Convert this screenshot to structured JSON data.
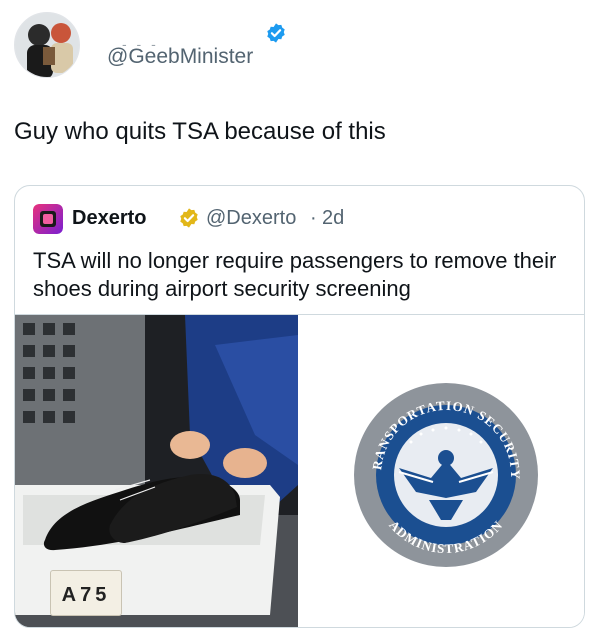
{
  "author": {
    "handle": "@GeebMinister",
    "name_redacted": "- - -",
    "verified_icon": "verified-badge-icon",
    "verified_color": "#1d9bf0"
  },
  "tweet": {
    "text": "Guy who quits TSA because of this"
  },
  "quoted": {
    "name": "Dexerto",
    "badge_icon": "gold-verified-badge-icon",
    "badge_color": "#e2b719",
    "handle": "@Dexerto",
    "separator": "·",
    "time": "2d",
    "text": "TSA will no longer require passengers to remove their shoes during airport security screening",
    "media": {
      "left_photo": "shoes-in-security-bin-photo",
      "bin_label": "A75",
      "right_image": "tsa-seal-logo",
      "seal_text_top": "TRANSPORTATION SECURITY",
      "seal_text_bottom": "ADMINISTRATION"
    }
  },
  "colors": {
    "text": "#0f1419",
    "muted": "#536471",
    "border": "#cfd9de",
    "seal_blue": "#1b4f91",
    "seal_grey": "#8e949b"
  }
}
